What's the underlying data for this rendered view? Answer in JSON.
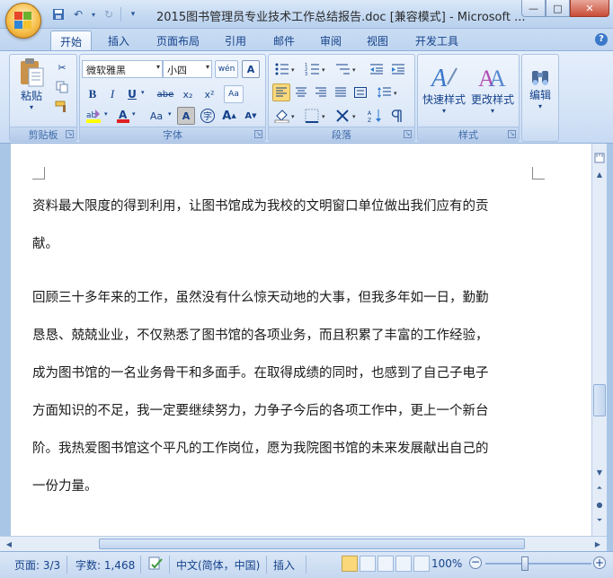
{
  "window": {
    "title": "2015图书管理员专业技术工作总结报告.doc [兼容模式] - Microsoft ...",
    "minimize": "—",
    "maximize": "□",
    "close": "✕"
  },
  "tabs": [
    "开始",
    "插入",
    "页面布局",
    "引用",
    "邮件",
    "审阅",
    "视图",
    "开发工具"
  ],
  "ribbon": {
    "clipboard": {
      "label": "剪贴板",
      "paste": "粘贴"
    },
    "font": {
      "label": "字体",
      "font_name": "微软雅黑",
      "font_size": "小四",
      "bold": "B",
      "italic": "I",
      "underline": "U",
      "strike": "abe",
      "subscript": "x₂",
      "superscript": "x²",
      "clear": "Aa",
      "grow": "A",
      "shrink": "A",
      "change_case": "Aa",
      "phonetic": "wén",
      "char_border": "A"
    },
    "paragraph": {
      "label": "段落"
    },
    "styles": {
      "label": "样式",
      "quick_styles": "快速样式",
      "change_styles": "更改样式"
    },
    "editing": {
      "label": "编辑",
      "edit": "编辑"
    }
  },
  "document": {
    "lines": [
      "资料最大限度的得到利用，让图书馆成为我校的文明窗口单位做出我们应有的贡",
      "献。",
      "回顾三十多年来的工作，虽然没有什么惊天动地的大事，但我多年如一日，勤勤",
      "恳恳、兢兢业业，不仅熟悉了图书馆的各项业务，而且积累了丰富的工作经验，",
      "成为图书馆的一名业务骨干和多面手。在取得成绩的同时，也感到了自己子电子",
      "方面知识的不足，我一定要继续努力，力争子今后的各项工作中，更上一个新台",
      "阶。我热爱图书馆这个平凡的工作岗位，愿为我院图书馆的未来发展献出自己的",
      "一份力量。"
    ]
  },
  "statusbar": {
    "page": "页面: 3/3",
    "words": "字数: 1,468",
    "language": "中文(简体，中国)",
    "mode": "插入",
    "zoom": "100%"
  },
  "colors": {
    "accent": "#15428b",
    "font_color_bar": "#e02020",
    "highlight_bar": "#ffff00"
  }
}
